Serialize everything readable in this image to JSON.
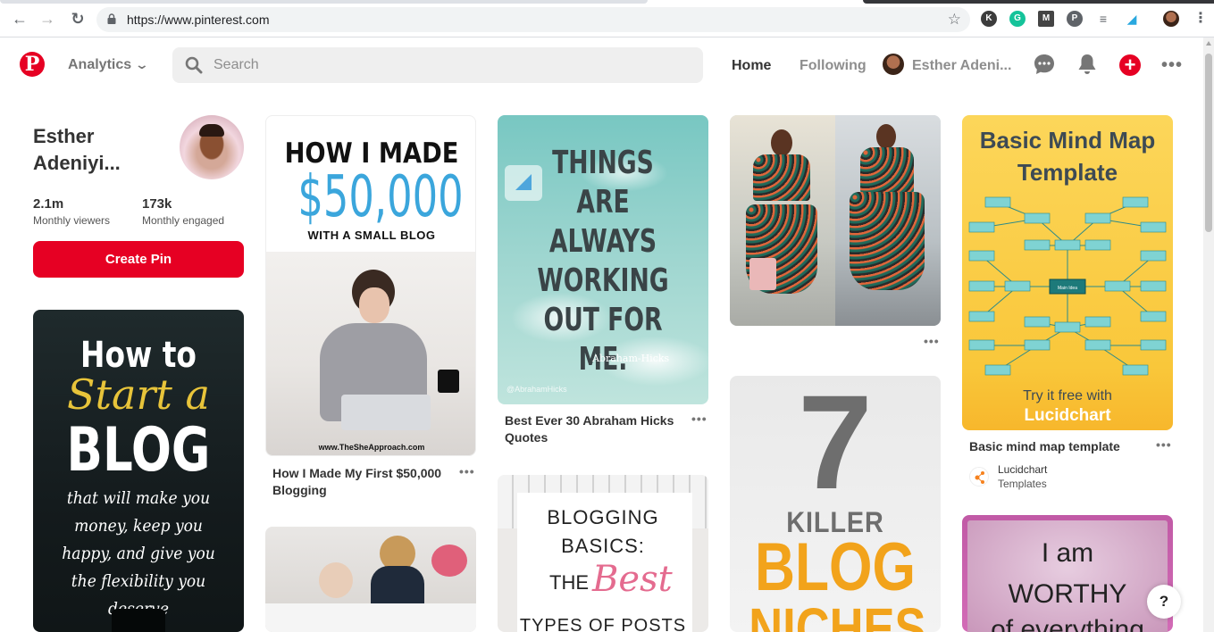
{
  "browser": {
    "url": "https://www.pinterest.com",
    "nav": {
      "back": "←",
      "forward": "→",
      "reload": "↻"
    },
    "star": "☆",
    "extensions": [
      {
        "name": "k-extension-icon",
        "letter": "K",
        "color": "#3c3c3c"
      },
      {
        "name": "grammarly-icon",
        "letter": "G",
        "color": "#15c39a"
      },
      {
        "name": "m-extension-icon",
        "letter": "M",
        "color": "#444444"
      },
      {
        "name": "pinterest-extension-icon",
        "letter": "P",
        "color": "#5f6368"
      },
      {
        "name": "list-extension-icon",
        "letter": "≡",
        "color": "#5f6368"
      },
      {
        "name": "lucid-extension-icon",
        "letter": "◢",
        "color": "#29a8df"
      }
    ]
  },
  "header": {
    "logo": "P",
    "analytics_label": "Analytics",
    "search_placeholder": "Search",
    "nav_home": "Home",
    "nav_following": "Following",
    "profile_name": "Esther Adeni...",
    "plus": "+",
    "more": "•••",
    "brand_color": "#e60023"
  },
  "profile": {
    "name_line1": "Esther",
    "name_line2": "Adeniyi...",
    "stats": [
      {
        "value": "2.1m",
        "label": "Monthly viewers"
      },
      {
        "value": "173k",
        "label": "Monthly engaged"
      }
    ],
    "create_pin": "Create Pin"
  },
  "pins": {
    "blog": {
      "line1": "How to",
      "line2": "Start a",
      "line3": "BLOG",
      "line4": "that will make you money, keep you happy, and give you the flexibility you deserve"
    },
    "made": {
      "line1": "HOW I MADE",
      "line2": "$50,000",
      "line3": "WITH A SMALL BLOG",
      "credit": "www.TheSheApproach.com",
      "title": "How I Made My First $50,000 Blogging"
    },
    "quote": {
      "text": "THINGS ARE ALWAYS WORKING OUT FOR ME.",
      "author": "Abraham-Hicks",
      "watermark": "@AbrahamHicks",
      "title": "Best Ever 30 Abraham Hicks Quotes"
    },
    "mind": {
      "title": "Basic Mind Map Template",
      "try": "Try it free with",
      "brand": "Lucidchart",
      "center_node": "Main Idea",
      "pin_title": "Basic mind map template",
      "source_name": "Lucidchart",
      "source_sub": "Templates"
    },
    "basics": {
      "line1": "BLOGGING",
      "line2": "BASICS:",
      "line3": "THE",
      "line4": "Best",
      "line5": "TYPES OF POSTS"
    },
    "niches": {
      "number": "7",
      "line1": "KILLER",
      "line2": "BLOG",
      "line3": "NICHES"
    },
    "worthy": {
      "line1": "I am",
      "line2": "WORTHY",
      "line3": "of everything"
    },
    "dots": "•••"
  },
  "help": "?"
}
